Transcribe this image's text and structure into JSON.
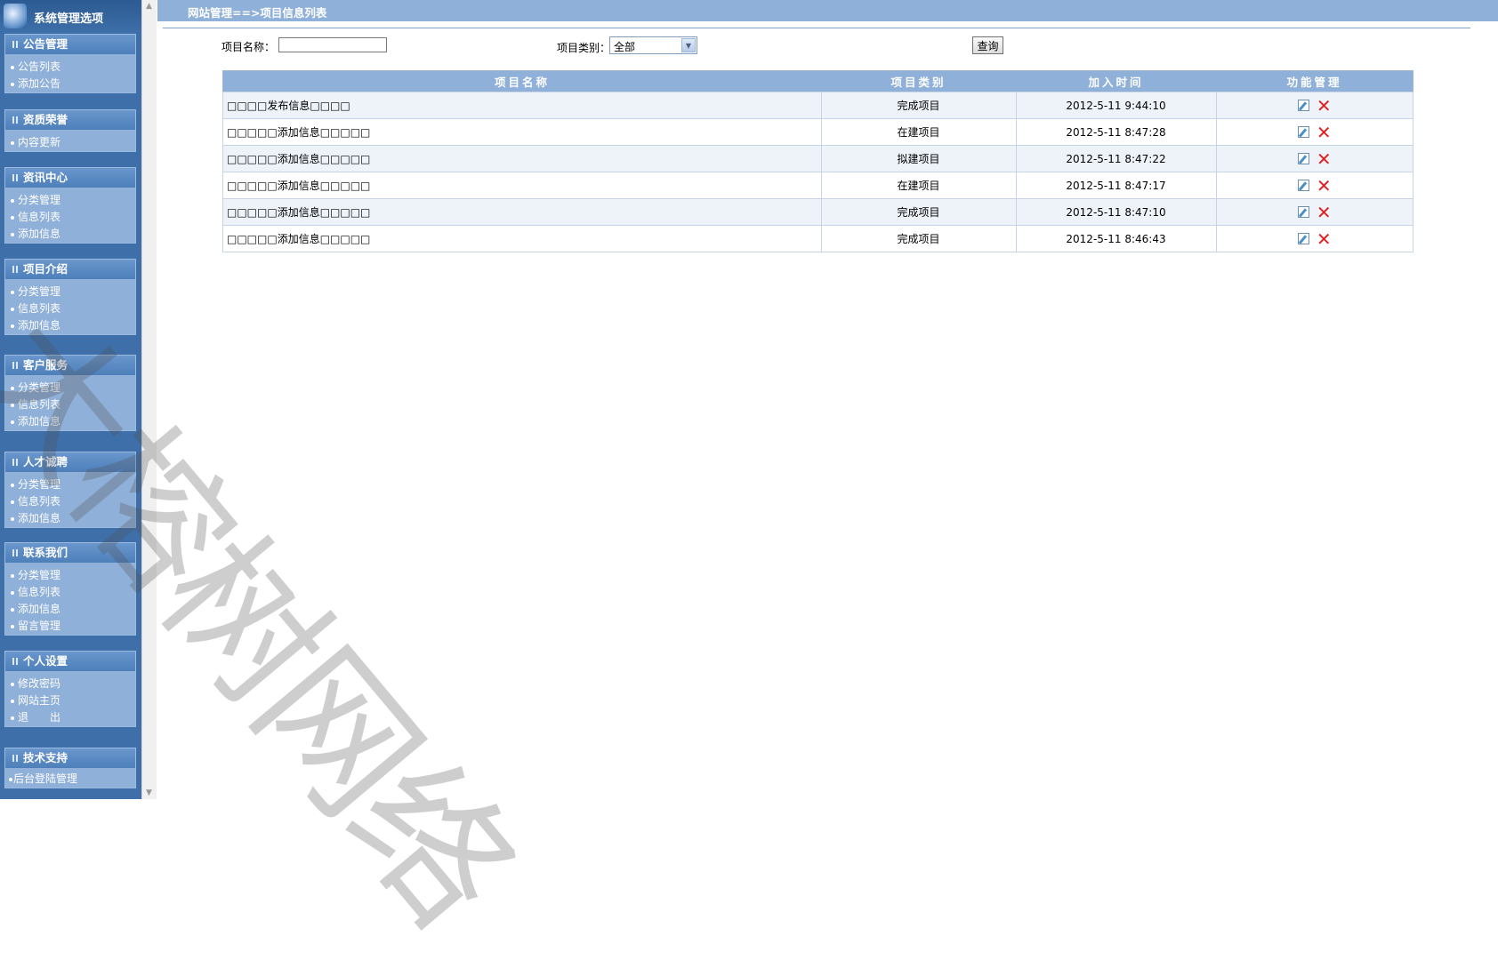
{
  "sidebar": {
    "title": "系统管理选项",
    "sections": [
      {
        "title": "公告管理",
        "items": [
          "公告列表",
          "添加公告"
        ]
      },
      {
        "title": "资质荣誉",
        "items": [
          "内容更新"
        ]
      },
      {
        "title": "资讯中心",
        "items": [
          "分类管理",
          "信息列表",
          "添加信息"
        ]
      },
      {
        "title": "项目介绍",
        "items": [
          "分类管理",
          "信息列表",
          "添加信息"
        ]
      },
      {
        "title": "客户服务",
        "items": [
          "分类管理",
          "信息列表",
          "添加信息"
        ]
      },
      {
        "title": "人才诚聘",
        "items": [
          "分类管理",
          "信息列表",
          "添加信息"
        ]
      },
      {
        "title": "联系我们",
        "items": [
          "分类管理",
          "信息列表",
          "添加信息",
          "留言管理"
        ]
      },
      {
        "title": "个人设置",
        "items": [
          "修改密码",
          "网站主页",
          "退　　出"
        ]
      },
      {
        "title": "技术支持",
        "items": [
          "后台登陆管理"
        ]
      }
    ]
  },
  "header": {
    "breadcrumb": "网站管理==>项目信息列表"
  },
  "search": {
    "name_label": "项目名称：",
    "name_value": "",
    "type_label": "项目类别：",
    "type_selected": "全部",
    "query_label": "查询"
  },
  "table": {
    "columns": [
      "项目名称",
      "项目类别",
      "加入时间",
      "功能管理"
    ],
    "rows": [
      {
        "name": "□□□□发布信息□□□□",
        "type": "完成项目",
        "time": "2012-5-11 9:44:10"
      },
      {
        "name": "□□□□□添加信息□□□□□",
        "type": "在建项目",
        "time": "2012-5-11 8:47:28"
      },
      {
        "name": "□□□□□添加信息□□□□□",
        "type": "拟建项目",
        "time": "2012-5-11 8:47:22"
      },
      {
        "name": "□□□□□添加信息□□□□□",
        "type": "在建项目",
        "time": "2012-5-11 8:47:17"
      },
      {
        "name": "□□□□□添加信息□□□□□",
        "type": "完成项目",
        "time": "2012-5-11 8:47:10"
      },
      {
        "name": "□□□□□添加信息□□□□□",
        "type": "完成项目",
        "time": "2012-5-11 8:46:43"
      }
    ]
  },
  "watermark": "大榕树网络",
  "icons": {
    "edit": "edit-icon",
    "delete": "delete-icon"
  },
  "colors": {
    "sidebar_bg": "#3e6fa8",
    "menu_bg": "#8fb0d8",
    "header_bg": "#8fb0d8",
    "delete_red": "#e02020"
  }
}
